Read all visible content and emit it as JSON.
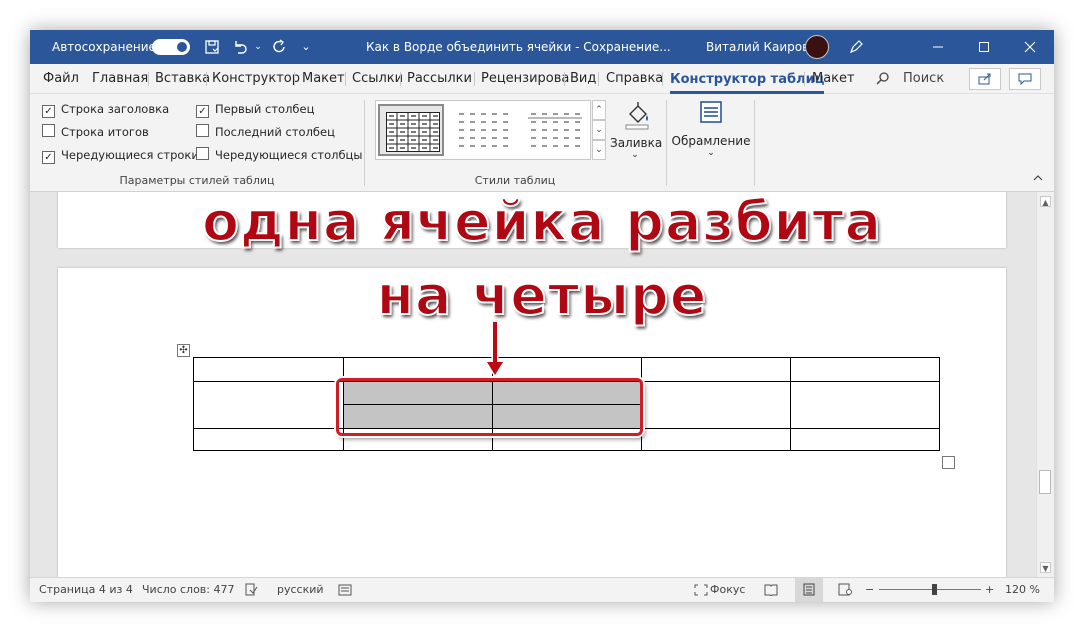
{
  "titlebar": {
    "autosave_label": "Автосохранение",
    "autosave_toggle": "Вкл.",
    "qat_icons": [
      "save-icon",
      "undo-icon",
      "redo-icon",
      "customize-qat-icon"
    ],
    "doc_title": "Как в Ворде объединить ячейки  -  Сохранение...",
    "title_dropdown": "⌄",
    "user_name": "Виталий Каиров",
    "window_controls": [
      "pen-icon",
      "minimize-icon",
      "maximize-icon",
      "close-icon"
    ]
  },
  "tabs": [
    {
      "label": "Файл"
    },
    {
      "label": "Главная"
    },
    {
      "label": "Вставка"
    },
    {
      "label": "Конструктор"
    },
    {
      "label": "Макет"
    },
    {
      "label": "Ссылки"
    },
    {
      "label": "Рассылки"
    },
    {
      "label": "Рецензирова"
    },
    {
      "label": "Вид"
    },
    {
      "label": "Справка"
    },
    {
      "label": "Конструктор таблиц",
      "active": true
    },
    {
      "label": "Макет"
    }
  ],
  "search_label": "Поиск",
  "ribbon": {
    "style_options": {
      "checkboxes": [
        {
          "label": "Строка заголовка",
          "checked": true
        },
        {
          "label": "Строка итогов",
          "checked": false
        },
        {
          "label": "Чередующиеся строки",
          "checked": true
        },
        {
          "label": "Первый столбец",
          "checked": true
        },
        {
          "label": "Последний столбец",
          "checked": false
        },
        {
          "label": "Чередующиеся столбцы",
          "checked": false
        }
      ],
      "group_label": "Параметры стилей таблиц"
    },
    "table_styles": {
      "group_label": "Стили таблиц",
      "shading_label": "Заливка"
    },
    "borders": {
      "label": "Обрамление"
    }
  },
  "annotation": {
    "line1": "одна ячейка разбита",
    "line2": "на четыре"
  },
  "status": {
    "page": "Страница 4 из 4",
    "words": "Число слов: 477",
    "language": "русский",
    "focus": "Фокус",
    "zoom_minus": "−",
    "zoom_plus": "+",
    "zoom": "120 %",
    "zoom_level_percent": 120
  },
  "colors": {
    "accent": "#2b579a",
    "annotation": "#b00712",
    "highlight_border": "#d21d24",
    "merged_cell_fill": "#c4c4c4"
  }
}
